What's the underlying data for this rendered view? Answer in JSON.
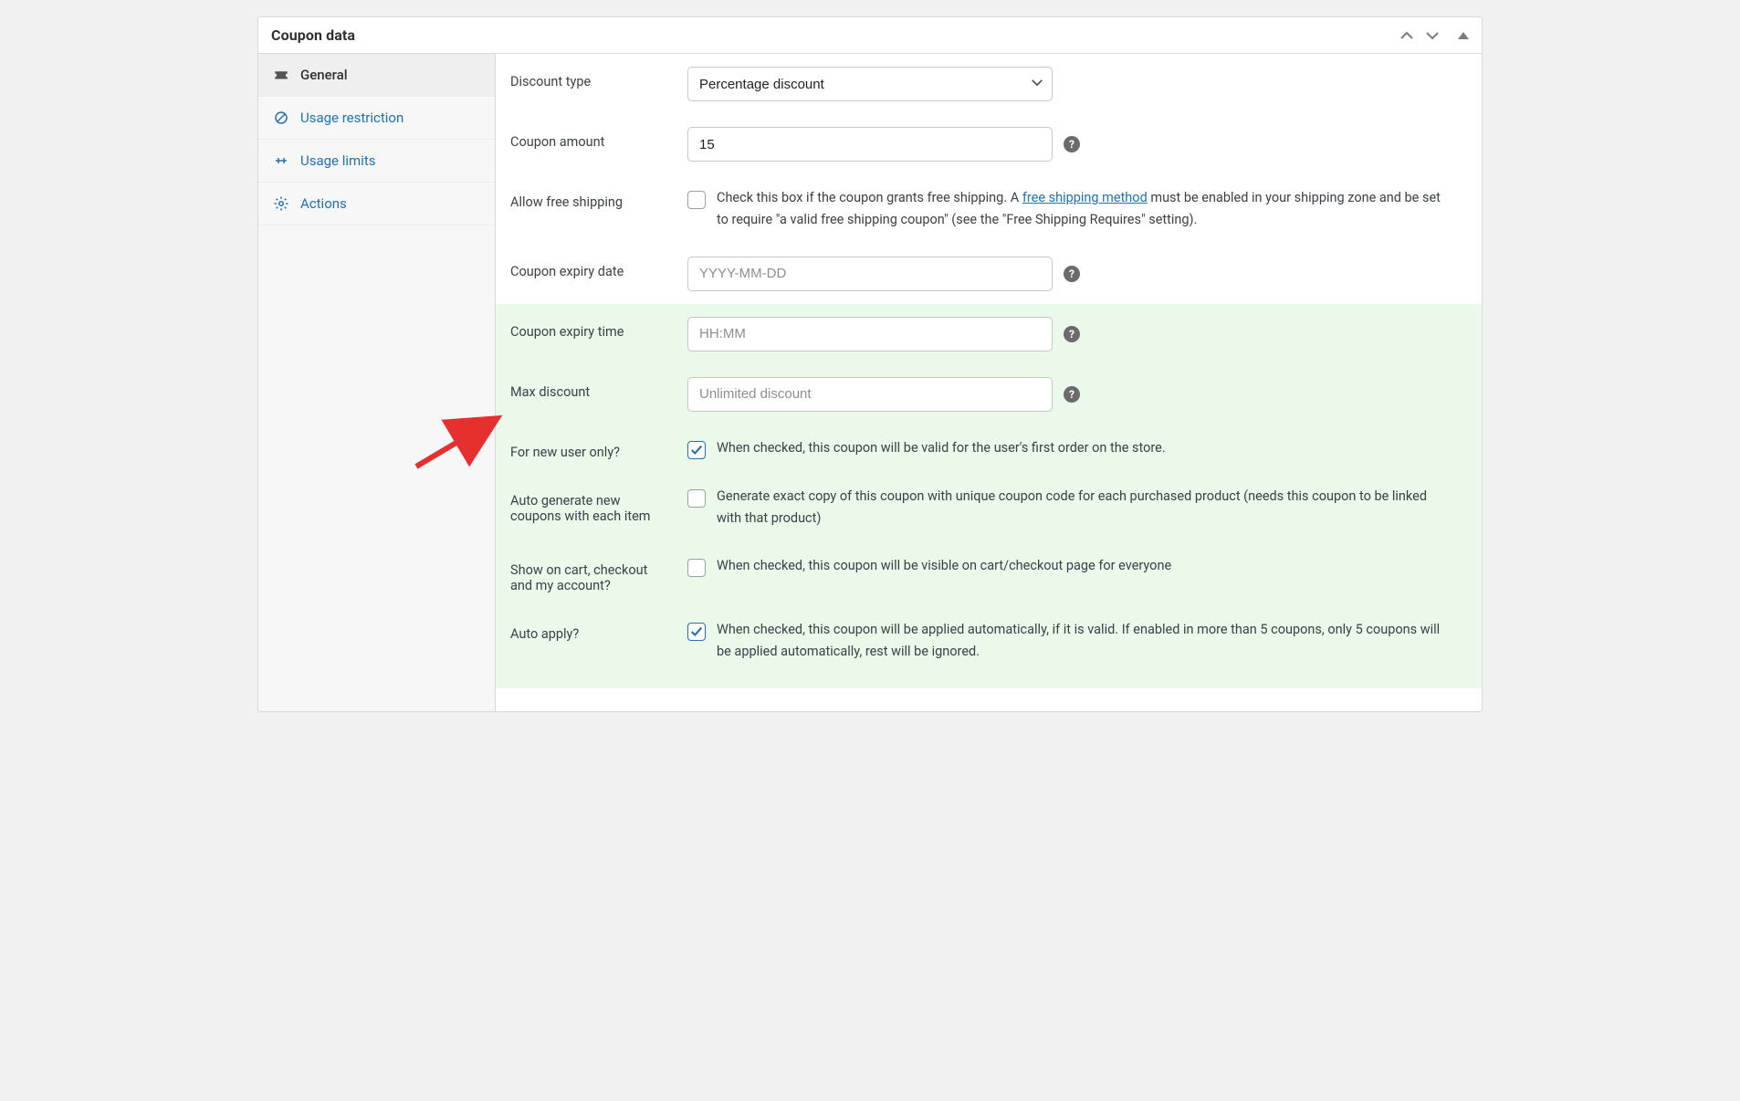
{
  "panel": {
    "title": "Coupon data"
  },
  "sidebar": {
    "items": [
      {
        "label": "General"
      },
      {
        "label": "Usage restriction"
      },
      {
        "label": "Usage limits"
      },
      {
        "label": "Actions"
      }
    ]
  },
  "fields": {
    "discount_type": {
      "label": "Discount type",
      "selected": "Percentage discount",
      "options": [
        "Percentage discount"
      ]
    },
    "coupon_amount": {
      "label": "Coupon amount",
      "value": "15"
    },
    "free_shipping": {
      "label": "Allow free shipping",
      "checked": false,
      "desc_before": "Check this box if the coupon grants free shipping. A ",
      "link_text": "free shipping method",
      "desc_after": " must be enabled in your shipping zone and be set to require \"a valid free shipping coupon\" (see the \"Free Shipping Requires\" setting)."
    },
    "expiry_date": {
      "label": "Coupon expiry date",
      "placeholder": "YYYY-MM-DD"
    },
    "expiry_time": {
      "label": "Coupon expiry time",
      "placeholder": "HH:MM"
    },
    "max_discount": {
      "label": "Max discount",
      "placeholder": "Unlimited discount"
    },
    "new_user": {
      "label": "For new user only?",
      "checked": true,
      "desc": "When checked, this coupon will be valid for the user's first order on the store."
    },
    "auto_generate": {
      "label": "Auto generate new coupons with each item",
      "checked": false,
      "desc": "Generate exact copy of this coupon with unique coupon code for each purchased product (needs this coupon to be linked with that product)"
    },
    "show_on": {
      "label": "Show on cart, checkout and my account?",
      "checked": false,
      "desc": "When checked, this coupon will be visible on cart/checkout page for everyone"
    },
    "auto_apply": {
      "label": "Auto apply?",
      "checked": true,
      "desc": "When checked, this coupon will be applied automatically, if it is valid. If enabled in more than 5 coupons, only 5 coupons will be applied automatically, rest will be ignored."
    }
  }
}
